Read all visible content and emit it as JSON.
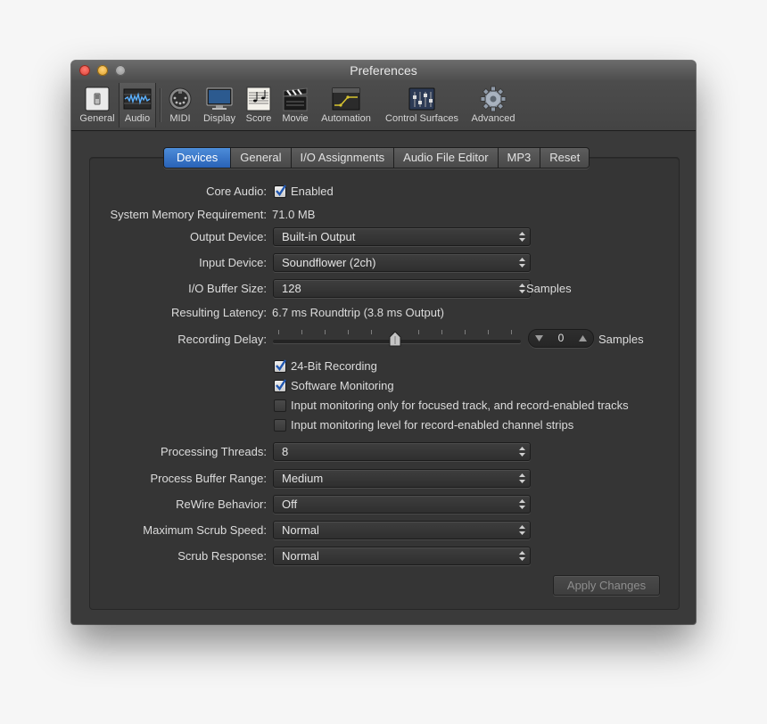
{
  "window": {
    "title": "Preferences"
  },
  "toolbar": [
    {
      "label": "General",
      "icon": "switch-icon"
    },
    {
      "label": "Audio",
      "icon": "audio-waveform-icon",
      "selected": true
    },
    {
      "label": "MIDI",
      "icon": "midi-connector-icon"
    },
    {
      "label": "Display",
      "icon": "monitor-icon"
    },
    {
      "label": "Score",
      "icon": "sheet-music-icon"
    },
    {
      "label": "Movie",
      "icon": "clapperboard-icon"
    },
    {
      "label": "Automation",
      "icon": "automation-curve-icon"
    },
    {
      "label": "Control Surfaces",
      "icon": "faders-icon"
    },
    {
      "label": "Advanced",
      "icon": "gear-icon"
    }
  ],
  "tabs": [
    "Devices",
    "General",
    "I/O Assignments",
    "Audio File Editor",
    "MP3",
    "Reset"
  ],
  "active_tab": "Devices",
  "form": {
    "core_audio": {
      "label": "Core Audio:",
      "checkbox_label": "Enabled",
      "checked": true
    },
    "memory": {
      "label": "System Memory Requirement:",
      "value": "71.0 MB"
    },
    "output_device": {
      "label": "Output Device:",
      "value": "Built-in Output"
    },
    "input_device": {
      "label": "Input Device:",
      "value": "Soundflower (2ch)"
    },
    "buffer_size": {
      "label": "I/O Buffer Size:",
      "value": "128",
      "unit": "Samples"
    },
    "latency": {
      "label": "Resulting Latency:",
      "value": "6.7 ms Roundtrip (3.8 ms Output)"
    },
    "recording_delay": {
      "label": "Recording Delay:",
      "value": "0",
      "unit": "Samples",
      "slider_position": 0.5
    },
    "checkboxes": [
      {
        "label": "24-Bit Recording",
        "checked": true
      },
      {
        "label": "Software Monitoring",
        "checked": true
      },
      {
        "label": "Input monitoring only for focused track, and record-enabled tracks",
        "checked": false
      },
      {
        "label": "Input monitoring level for record-enabled channel strips",
        "checked": false
      }
    ],
    "processing_threads": {
      "label": "Processing Threads:",
      "value": "8"
    },
    "process_buffer_range": {
      "label": "Process Buffer Range:",
      "value": "Medium"
    },
    "rewire_behavior": {
      "label": "ReWire Behavior:",
      "value": "Off"
    },
    "max_scrub_speed": {
      "label": "Maximum Scrub Speed:",
      "value": "Normal"
    },
    "scrub_response": {
      "label": "Scrub Response:",
      "value": "Normal"
    }
  },
  "buttons": {
    "apply": "Apply Changes"
  },
  "colors": {
    "accent": "#2f6bc0",
    "window_bg": "#3a3a3a"
  }
}
